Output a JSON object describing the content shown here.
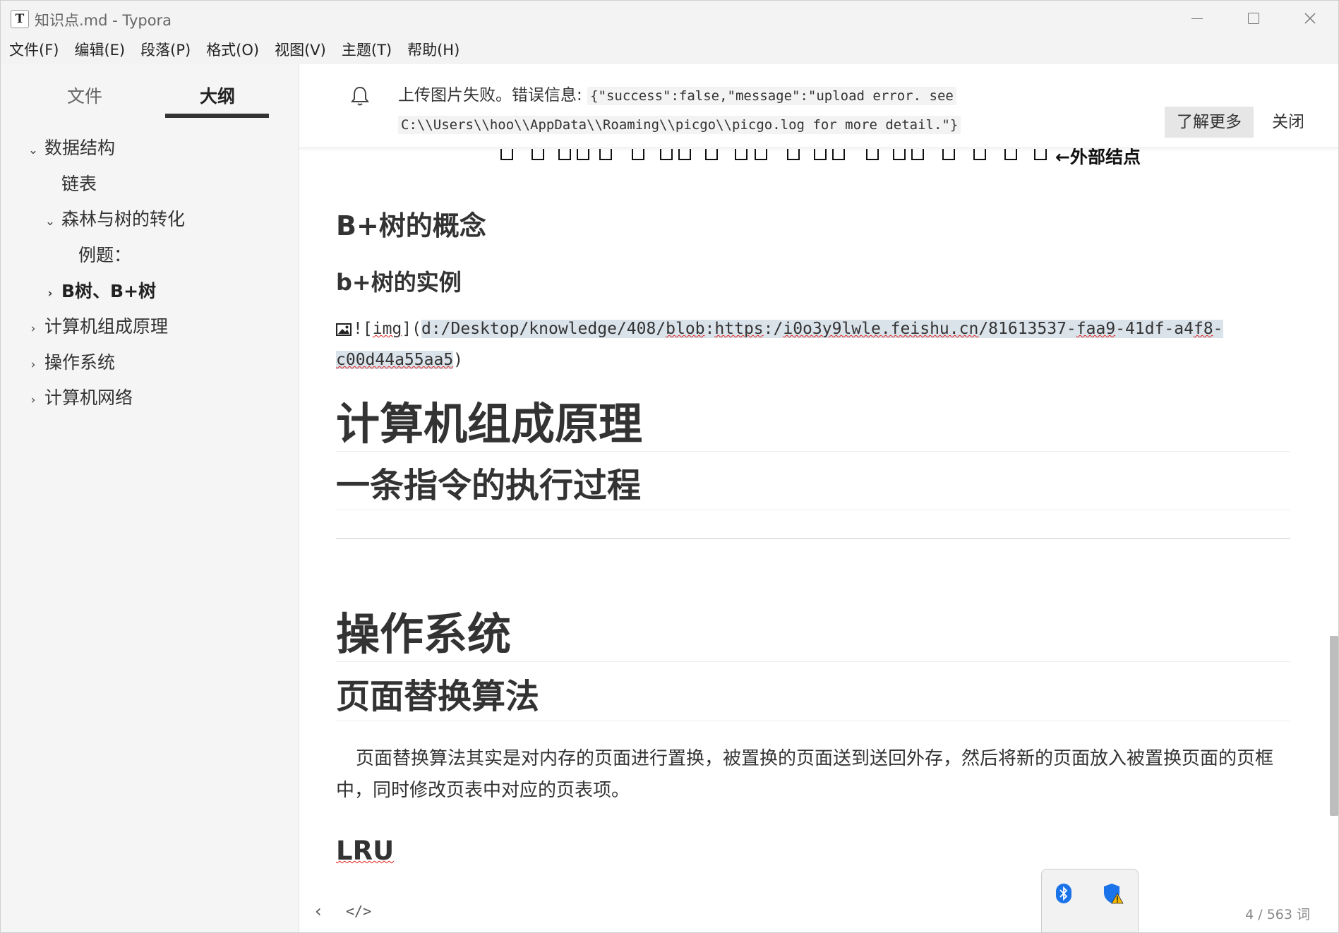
{
  "window": {
    "title": "知识点.md - Typora",
    "app_icon": "T",
    "controls": [
      "minimize",
      "maximize",
      "close"
    ]
  },
  "menu": [
    "文件(F)",
    "编辑(E)",
    "段落(P)",
    "格式(O)",
    "视图(V)",
    "主题(T)",
    "帮助(H)"
  ],
  "sidebar": {
    "tabs": {
      "files": "文件",
      "outline": "大纲"
    },
    "active_tab": "outline",
    "outline": [
      {
        "label": "数据结构",
        "chevron": "⌄",
        "level": 0
      },
      {
        "label": "链表",
        "chevron": "",
        "level": 1
      },
      {
        "label": "森林与树的转化",
        "chevron": "⌄",
        "level": 1
      },
      {
        "label": "例题：",
        "chevron": "",
        "level": 2
      },
      {
        "label": "B树、B+树",
        "chevron": "›",
        "level": 1,
        "active": true
      },
      {
        "label": "计算机组成原理",
        "chevron": "›",
        "level": 0
      },
      {
        "label": "操作系统",
        "chevron": "›",
        "level": 0
      },
      {
        "label": "计算机网络",
        "chevron": "›",
        "level": 0
      }
    ]
  },
  "notice": {
    "prefix": "上传图片失败。错误信息: ",
    "detail_line1": "{\"success\":false,\"message\":\"upload error. see",
    "detail_line2": "C:\\\\Users\\\\hoo\\\\AppData\\\\Roaming\\\\picgo\\\\picgo.log for more detail.\"}",
    "learn_more": "了解更多",
    "close": "关闭"
  },
  "document": {
    "tree_label": "←外部结点",
    "h2_bplus_concept": "B+树的概念",
    "h3_bplus_example": "b+树的实例",
    "img_md": {
      "bang": "!",
      "bracket_open": "[",
      "alt": "img",
      "bracket_close": "](",
      "path_a": "d:/Desktop/knowledge/408/",
      "path_b": "blob",
      "path_c": ":",
      "path_d": "https",
      "path_e": ":/",
      "path_f": "i0o3y9lwle.feishu.cn",
      "path_g": "/81613537-",
      "path_h": "faa9",
      "path_i": "-41df-a4",
      "path_j": "f8",
      "path_k": "-",
      "path_l": "c00d44a55aa5",
      "paren_close": ")"
    },
    "h1_computer_org": "计算机组成原理",
    "h2_instruction": "一条指令的执行过程",
    "h1_os": "操作系统",
    "h2_page_replace": "页面替换算法",
    "para_page_replace": "页面替换算法其实是对内存的页面进行置换，被置换的页面送到送回外存，然后将新的页面放入被置换页面的页框中，同时修改页表中对应的页表项。",
    "h3_lru": "LRU"
  },
  "footer": {
    "back": "‹",
    "source_mode": "</>",
    "word_count": "4 / 563 词"
  },
  "colors": {
    "chrome_bg": "#f3f3f3",
    "sidebar_bg": "#f5f5f5",
    "highlight": "#dbe3ea",
    "spellcheck": "#e02020",
    "bluetooth": "#1a73e8"
  },
  "tray_icons": [
    "bluetooth-icon",
    "security-warning-icon"
  ]
}
